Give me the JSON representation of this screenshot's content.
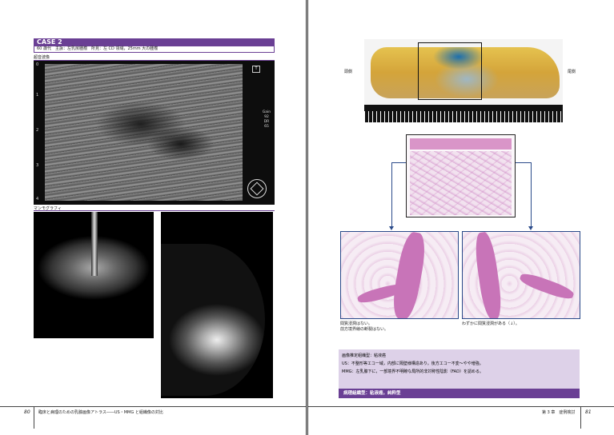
{
  "left_page": {
    "case_title": "CASE 2",
    "case_description": "60 歳代　主訴：左乳房腫瘤　所見：左 CD 領域，25mm 大の腫瘤",
    "ultrasound_label": "超音波像",
    "ultrasound": {
      "depth_ticks": [
        "0",
        "1",
        "2",
        "3",
        "4"
      ],
      "t_marker": "T",
      "info_lines": [
        "Gain",
        "92",
        "DR",
        "65"
      ]
    },
    "mammography_label": "マンモグラフィ",
    "page_number": "80",
    "running_footer": "臨床と病理のための乳腺画像アトラス――US・MMG と組織像の対比"
  },
  "right_page": {
    "specimen_label_left": "頭側",
    "specimen_label_right": "尾側",
    "caption_left_line1": "間質浸潤はない。",
    "caption_left_line2": "前方境界線の断裂はない。",
    "caption_right": "わずかに間質浸潤がある（↓）。",
    "diagnosis": {
      "imaging_dx": "画像推定組織型：粘液癌",
      "us_finding": "US：不整形等エコー域，内部に隔壁様構造あり。後方エコー不変～やや増強。",
      "mmg_finding": "MMG：左乳腺下に，一部境界不明瞭な局所的非対称性陰影（FAD）を認める。",
      "pathology_dx": "病理組織型：粘液癌，純粋型"
    },
    "running_footer": "第 3 章　症例検討",
    "page_number": "81"
  }
}
